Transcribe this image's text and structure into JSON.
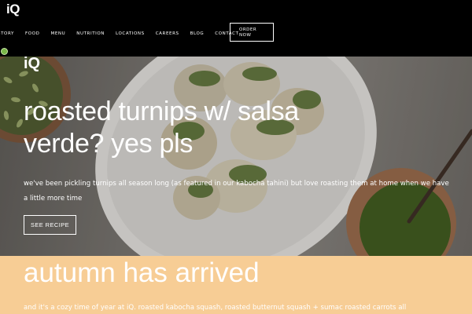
{
  "brand": {
    "logo": "iQ",
    "hero_logo": "iQ"
  },
  "nav": {
    "items": [
      {
        "label": "story"
      },
      {
        "label": "food"
      },
      {
        "label": "menu"
      },
      {
        "label": "nutrition"
      },
      {
        "label": "locations"
      },
      {
        "label": "careers"
      },
      {
        "label": "blog"
      },
      {
        "label": "contact"
      }
    ],
    "order_line1": "ORDER",
    "order_line2": "NOW"
  },
  "hero": {
    "title_line1": "roasted turnips w/ salsa",
    "title_line2": "verde? yes pls",
    "text": "we've been pickling turnips all season long (as featured in our kabocha tahini) but love roasting them at home when we have a little more time",
    "button_label": "SEE RECIPE"
  },
  "autumn": {
    "title": "autumn has arrived",
    "text": "and it's a cozy time of year at iQ. roasted kabocha squash, roasted butternut squash + sumac roasted carrots all"
  },
  "colors": {
    "nav_bg": "#000000",
    "autumn_bg": "#f7cd95",
    "hero_text": "#ffffff",
    "leaf_badge": "#7ab648"
  },
  "icons": {
    "leaf_badge": "leaf-icon"
  }
}
